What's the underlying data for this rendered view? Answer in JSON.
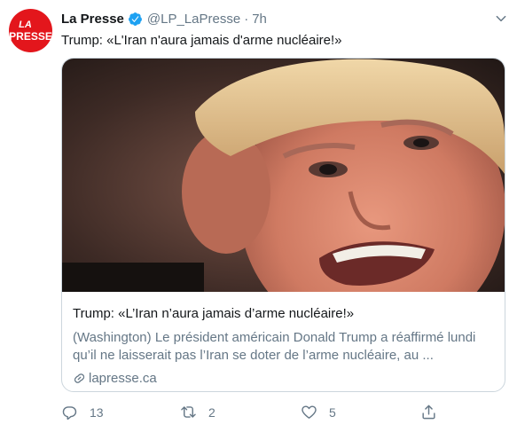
{
  "author": {
    "avatar_line1": "LA",
    "avatar_line2": "PRESSE",
    "display_name": "La Presse",
    "handle": "@LP_LaPresse",
    "separator": "·",
    "time": "7h"
  },
  "tweet": {
    "text": "Trump: «L'Iran n'aura jamais d'arme nucléaire!»"
  },
  "card": {
    "title": "Trump: «L’Iran n’aura jamais d’arme nucléaire!»",
    "description": "(Washington) Le président américain Donald Trump a réaffirmé lundi qu’il ne laisserait pas l’Iran se doter de l’arme nucléaire, au ...",
    "domain": "lapresse.ca"
  },
  "actions": {
    "reply_count": "13",
    "retweet_count": "2",
    "like_count": "5"
  },
  "colors": {
    "avatar_bg": "#e3161c",
    "verified": "#1da1f2",
    "secondary_text": "#657786",
    "border": "#ccd6dd"
  },
  "icons": [
    "verified-badge-icon",
    "chevron-down-icon",
    "link-icon",
    "reply-icon",
    "retweet-icon",
    "like-icon",
    "share-icon"
  ]
}
